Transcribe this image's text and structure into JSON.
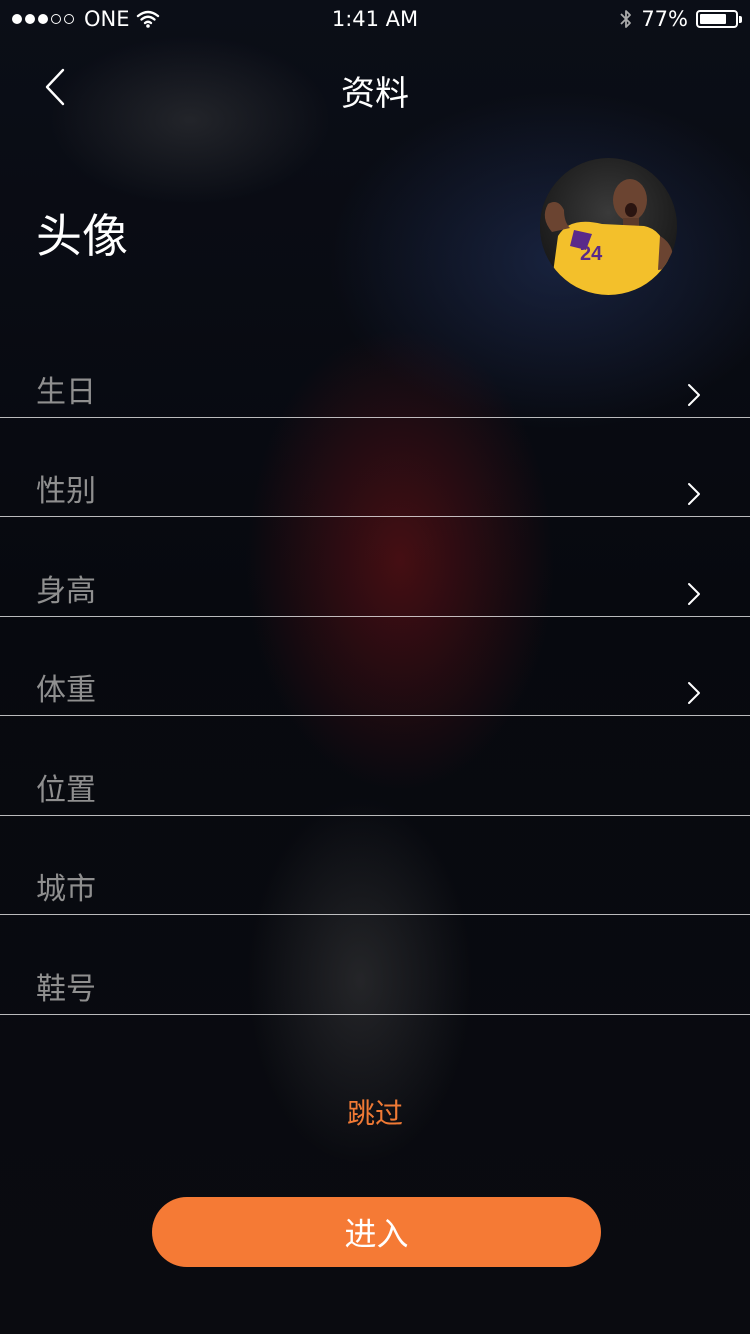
{
  "status_bar": {
    "carrier": "ONE",
    "time": "1:41 AM",
    "battery": "77%",
    "battery_level": 0.77
  },
  "nav": {
    "title": "资料",
    "back_icon": "chevron-left-icon"
  },
  "avatar": {
    "label": "头像"
  },
  "fields": [
    {
      "label": "生日",
      "has_arrow": true
    },
    {
      "label": "性别",
      "has_arrow": true
    },
    {
      "label": "身高",
      "has_arrow": true
    },
    {
      "label": "体重",
      "has_arrow": true
    },
    {
      "label": "位置",
      "has_arrow": false
    },
    {
      "label": "城市",
      "has_arrow": false
    },
    {
      "label": "鞋号",
      "has_arrow": false
    }
  ],
  "actions": {
    "skip_label": "跳过",
    "enter_label": "进入"
  },
  "colors": {
    "accent": "#f57a35",
    "text_primary": "#ffffff",
    "text_muted": "#8f8f8f"
  }
}
